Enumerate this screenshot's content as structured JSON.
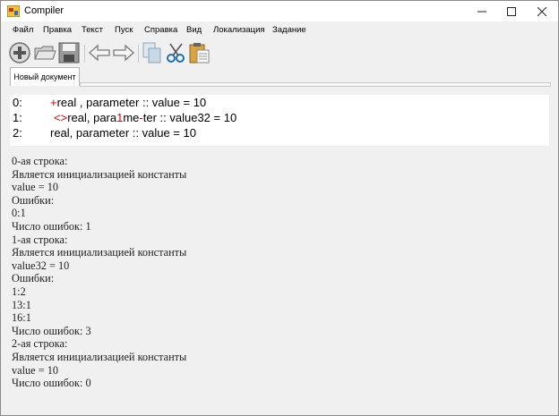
{
  "window": {
    "title": "Compiler",
    "minimize": "—",
    "maximize": "☐",
    "close": "✕"
  },
  "menu": [
    "Файл",
    "Правка",
    "Текст",
    "Пуск",
    "Справка",
    "Вид",
    "Локализация",
    "Задание"
  ],
  "toolbar": {
    "icons": [
      "new-icon",
      "open-folder-icon",
      "save-icon",
      "undo-arrow-icon",
      "redo-arrow-icon",
      "copy-icon",
      "cut-icon",
      "paste-icon"
    ]
  },
  "tabs": [
    {
      "label": "Новый документ",
      "active": true
    }
  ],
  "editor": {
    "lines": [
      {
        "num": "0:",
        "segments": [
          {
            "text": "+",
            "error": true
          },
          {
            "text": "real , parameter :: value = 10",
            "error": false
          }
        ]
      },
      {
        "num": "1:",
        "segments": [
          {
            "text": "<>",
            "error": true
          },
          {
            "text": "real, para",
            "error": false
          },
          {
            "text": "1",
            "error": true
          },
          {
            "text": "me",
            "error": false
          },
          {
            "text": "-",
            "error": true
          },
          {
            "text": "ter :: value32 = 10",
            "error": false
          }
        ]
      },
      {
        "num": "2:",
        "segments": [
          {
            "text": "real, parameter :: value = 10",
            "error": false
          }
        ]
      }
    ]
  },
  "output": [
    "0-ая строка:",
    "Является инициализацией константы",
    "value = 10",
    "Ошибки:",
    "0:1",
    "Число ошибок: 1",
    "1-ая строка:",
    "Является инициализацией константы",
    "value32 = 10",
    "Ошибки:",
    "1:2",
    "13:1",
    "16:1",
    "Число ошибок: 3",
    "2-ая строка:",
    "Является инициализацией константы",
    "value = 10",
    "Число ошибок: 0"
  ],
  "colors": {
    "error": "#e00000",
    "editor_bg": "#ffffff",
    "window_bg": "#f0f0f0"
  }
}
